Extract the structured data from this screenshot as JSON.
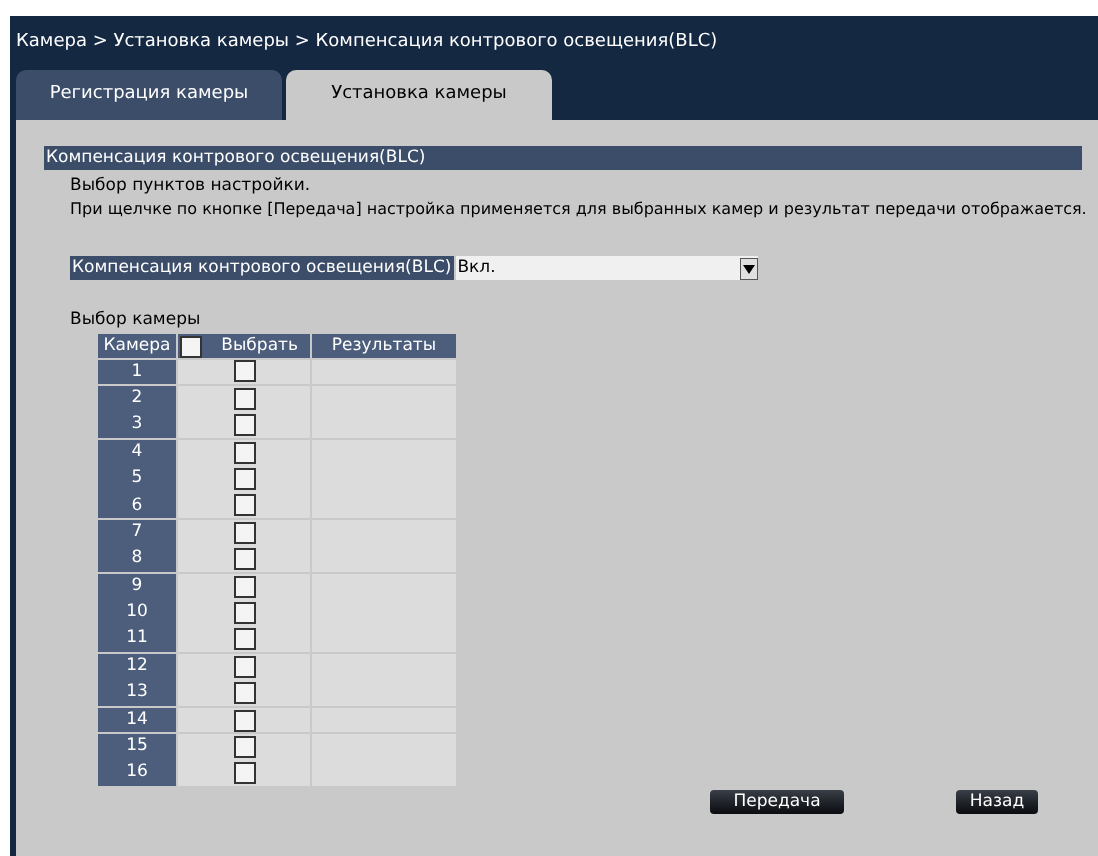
{
  "breadcrumb": "Камера > Установка камеры > Компенсация контрового освещения(BLC)",
  "tabs": [
    {
      "label": "Регистрация камеры",
      "selected": false
    },
    {
      "label": "Установка камеры",
      "selected": true
    }
  ],
  "section_title": "Компенсация контрового освещения(BLC)",
  "instructions": [
    "Выбор пунктов настройки.",
    "При щелчке по кнопке [Передача] настройка применяется для выбранных камер и результат передачи отображается."
  ],
  "setting": {
    "label": "Компенсация контрового освещения(BLC)",
    "value": "Вкл."
  },
  "camera_select": {
    "title": "Выбор камеры",
    "columns": [
      "Камера",
      "Выбрать",
      "Результаты"
    ],
    "select_all_checked": false,
    "rows": [
      {
        "camera": "1",
        "checked": false
      },
      {
        "camera": "2",
        "checked": false
      },
      {
        "camera": "3",
        "checked": false
      },
      {
        "camera": "4",
        "checked": false
      },
      {
        "camera": "5",
        "checked": false
      },
      {
        "camera": "6",
        "checked": false
      },
      {
        "camera": "7",
        "checked": false
      },
      {
        "camera": "8",
        "checked": false
      },
      {
        "camera": "9",
        "checked": false
      },
      {
        "camera": "10",
        "checked": false
      },
      {
        "camera": "11",
        "checked": false
      },
      {
        "camera": "12",
        "checked": false
      },
      {
        "camera": "13",
        "checked": false
      },
      {
        "camera": "14",
        "checked": false
      },
      {
        "camera": "15",
        "checked": false
      },
      {
        "camera": "16",
        "checked": false
      }
    ]
  },
  "buttons": [
    "Передача",
    "Назад"
  ]
}
